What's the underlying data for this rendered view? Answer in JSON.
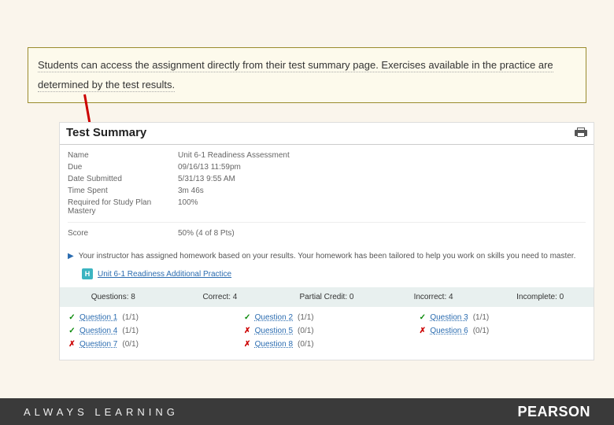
{
  "callout": "Students can access the assignment directly from their test summary page. Exercises available in the practice are determined by the test results.",
  "page_title": "Test Summary",
  "meta": {
    "name_label": "Name",
    "name_value": "Unit 6-1 Readiness Assessment",
    "due_label": "Due",
    "due_value": "09/16/13 11:59pm",
    "submitted_label": "Date Submitted",
    "submitted_value": "5/31/13 9:55 AM",
    "time_label": "Time Spent",
    "time_value": "3m 46s",
    "required_label": "Required for Study Plan Mastery",
    "required_value": "100%",
    "score_label": "Score",
    "score_value": "50% (4 of 8 Pts)"
  },
  "notice": {
    "text": "Your instructor has assigned homework based on your results. Your homework has been tailored to help you work on skills you need to master.",
    "badge": "H",
    "link_text": "Unit 6-1 Readiness Additional Practice"
  },
  "stats": {
    "questions": "Questions: 8",
    "correct": "Correct: 4",
    "partial": "Partial Credit: 0",
    "incorrect": "Incorrect: 4",
    "incomplete": "Incomplete: 0"
  },
  "questions": [
    {
      "correct": true,
      "label": "Question 1",
      "pts": "(1/1)"
    },
    {
      "correct": true,
      "label": "Question 2",
      "pts": "(1/1)"
    },
    {
      "correct": true,
      "label": "Question 3",
      "pts": "(1/1)"
    },
    {
      "correct": true,
      "label": "Question 4",
      "pts": "(1/1)"
    },
    {
      "correct": false,
      "label": "Question 5",
      "pts": "(0/1)"
    },
    {
      "correct": false,
      "label": "Question 6",
      "pts": "(0/1)"
    },
    {
      "correct": false,
      "label": "Question 7",
      "pts": "(0/1)"
    },
    {
      "correct": false,
      "label": "Question 8",
      "pts": "(0/1)"
    }
  ],
  "footer": {
    "tagline": "ALWAYS LEARNING",
    "brand": "PEARSON"
  }
}
